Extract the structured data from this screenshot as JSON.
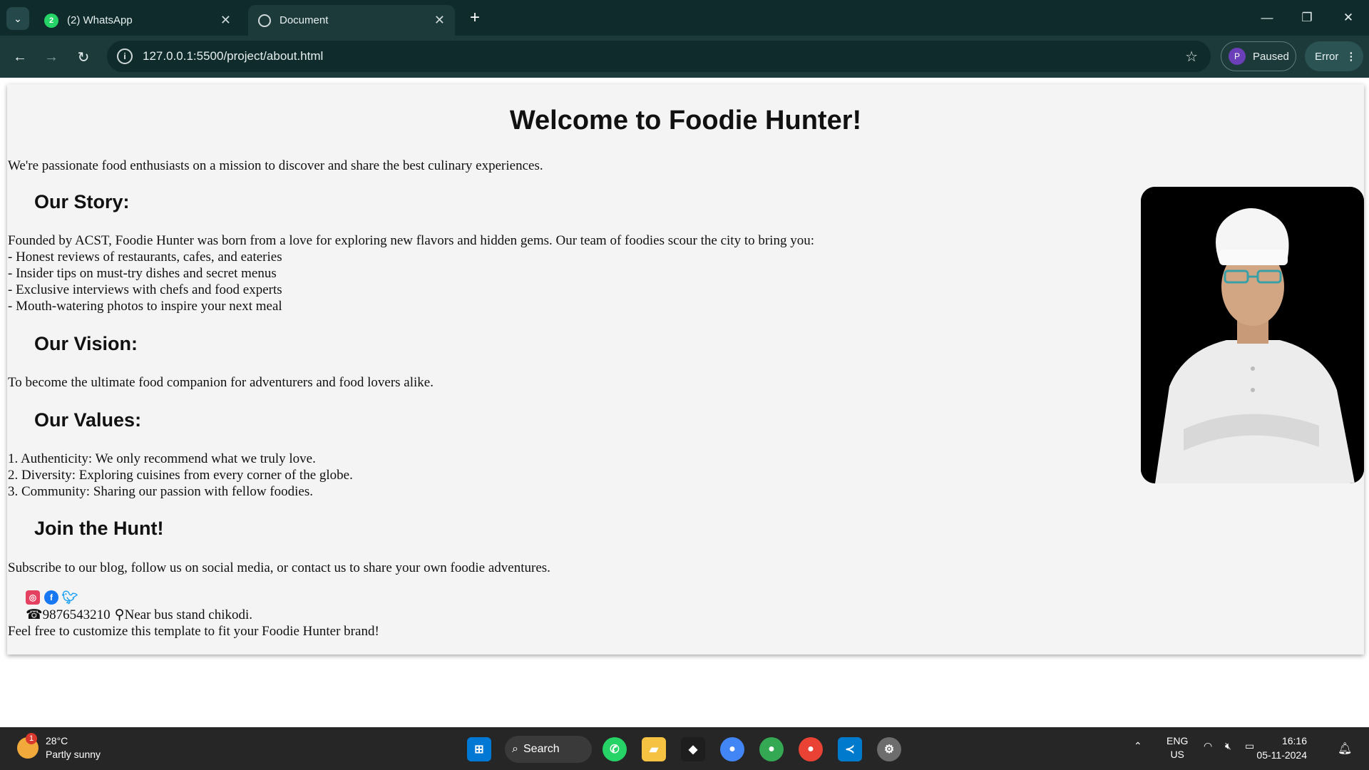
{
  "browser": {
    "tabs": [
      {
        "label": "(2) WhatsApp",
        "badge": "2"
      },
      {
        "label": "Document"
      }
    ],
    "url": "127.0.0.1:5500/project/about.html",
    "profile_label": "Paused",
    "profile_initial": "P",
    "error_label": "Error"
  },
  "page": {
    "title": "Welcome to Foodie Hunter!",
    "intro": "We're passionate food enthusiasts on a mission to discover and share the best culinary experiences.",
    "story_heading": "Our Story:",
    "story_lines": [
      "Founded by ACST, Foodie Hunter was born from a love for exploring new flavors and hidden gems. Our team of foodies scour the city to bring you:",
      "- Honest reviews of restaurants, cafes, and eateries",
      "- Insider tips on must-try dishes and secret menus",
      "- Exclusive interviews with chefs and food experts",
      "- Mouth-watering photos to inspire your next meal"
    ],
    "vision_heading": "Our Vision:",
    "vision_text": "To become the ultimate food companion for adventurers and food lovers alike.",
    "values_heading": "Our Values:",
    "values_lines": [
      "1. Authenticity: We only recommend what we truly love.",
      "2. Diversity: Exploring cuisines from every corner of the globe.",
      "3. Community: Sharing our passion with fellow foodies."
    ],
    "join_heading": "Join the Hunt!",
    "join_text": "Subscribe to our blog, follow us on social media, or contact us to share your own foodie adventures.",
    "phone": "9876543210",
    "address": "Near bus stand chikodi.",
    "footer_note": "Feel free to customize this template to fit your Foodie Hunter brand!"
  },
  "taskbar": {
    "weather_temp": "28°C",
    "weather_desc": "Partly sunny",
    "weather_badge": "1",
    "search_label": "Search",
    "lang_top": "ENG",
    "lang_bottom": "US",
    "time": "16:16",
    "date": "05-11-2024"
  },
  "colors": {
    "chrome_dark": "#0f2b2b",
    "toolbar": "#1d3a3a",
    "page_bg": "#f4f4f4",
    "taskbar": "#262626"
  }
}
